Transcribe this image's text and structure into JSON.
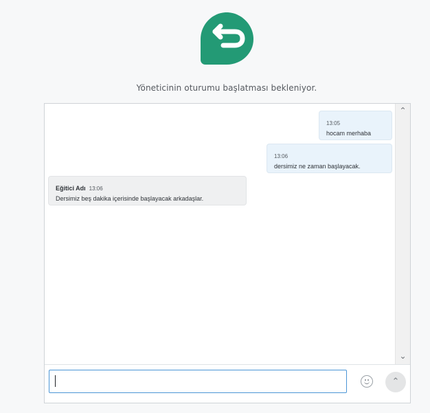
{
  "brand": {
    "logo_icon": "return-arrow-badge-icon",
    "accent_color": "#239a75"
  },
  "status": {
    "text": "Yöneticinin oturumu başlatması bekleniyor."
  },
  "messages": [
    {
      "direction": "out",
      "time": "13:05",
      "text": "hocam merhaba"
    },
    {
      "direction": "out",
      "time": "13:06",
      "text": "dersimiz ne zaman  başlayacak."
    },
    {
      "direction": "in",
      "sender": "Eğitici Adı",
      "time": "13:06",
      "text": "Dersimiz beş dakika içerisinde başlayacak arkadaşlar."
    }
  ],
  "composer": {
    "value": "",
    "placeholder": "",
    "emoji_icon": "smiley-icon",
    "send_icon": "chevron-up-icon"
  },
  "scrollbar": {
    "up_icon": "chevron-up-icon",
    "down_icon": "chevron-down-icon"
  }
}
